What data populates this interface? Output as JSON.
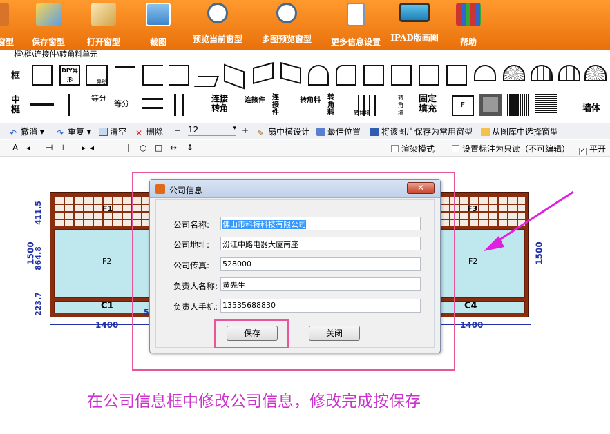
{
  "ribbon": {
    "items": [
      {
        "label": "窗型"
      },
      {
        "label": "保存窗型"
      },
      {
        "label": "打开窗型"
      },
      {
        "label": "截图"
      },
      {
        "label": "预览当前窗型"
      },
      {
        "label": "多图预览窗型"
      },
      {
        "label": "更多信息设置"
      },
      {
        "label": "IPAD版画图"
      },
      {
        "label": "帮助"
      }
    ]
  },
  "breadcrumb": "框\\梃\\连接件\\转角料单元",
  "palette": {
    "row_frame": "框",
    "row_mullion": "中梃",
    "diy_label": "DIY异形",
    "custom_label": "异形",
    "mullion_eq1": "等分",
    "mullion_eq2": "等分",
    "connect_corner": "连接转角",
    "connector1": "连接件",
    "connector2": "连接件",
    "corner1": "转角料",
    "corner2": "转角料",
    "corner_wall": "转角墙",
    "corner3": "转角墙",
    "fixed_fill": "固定填充",
    "f_label": "F",
    "wall": "墙体"
  },
  "toolbar": {
    "undo": "撤消",
    "redo": "重复",
    "clear": "清空",
    "delete": "删除",
    "font_size": "12",
    "sash_design": "扇中横设计",
    "best_position": "最佳位置",
    "save_common": "将该图片保存为常用窗型",
    "select_library": "从图库中选择窗型"
  },
  "toolbar2": {
    "text_tool": "A",
    "render_mode": "渲染模式",
    "readonly_label": "设置标注为只读（不可编辑）",
    "flat": "平开"
  },
  "drawing": {
    "dim_top_left": "411.5",
    "dim_mid_left": "864.8",
    "dim_bottom_left": "223.7",
    "dim_height": "1500",
    "dim_height_right": "1500",
    "dim_width_left": "1400",
    "dim_width_right": "1400",
    "f1": "F1",
    "f2": "F2",
    "f3": "F3",
    "f4": "F2",
    "c1": "C1",
    "c4": "C4",
    "partial": "5"
  },
  "dialog": {
    "title": "公司信息",
    "fields": [
      {
        "label": "公司名称:",
        "value": "佛山市科特科技有限公司"
      },
      {
        "label": "公司地址:",
        "value": "汾江中路电器大厦南座"
      },
      {
        "label": "公司传真:",
        "value": "528000"
      },
      {
        "label": "负责人名称:",
        "value": "黄先生"
      },
      {
        "label": "负责人手机:",
        "value": "13535688830"
      }
    ],
    "save": "保存",
    "close": "关闭"
  },
  "caption": "在公司信息框中修改公司信息，修改完成按保存",
  "colors": {
    "ribbon": "#f28a1a",
    "highlight": "#e8559a",
    "caption": "#cc33cc",
    "frame": "#8a2e10",
    "glass": "#bfe8ee"
  }
}
